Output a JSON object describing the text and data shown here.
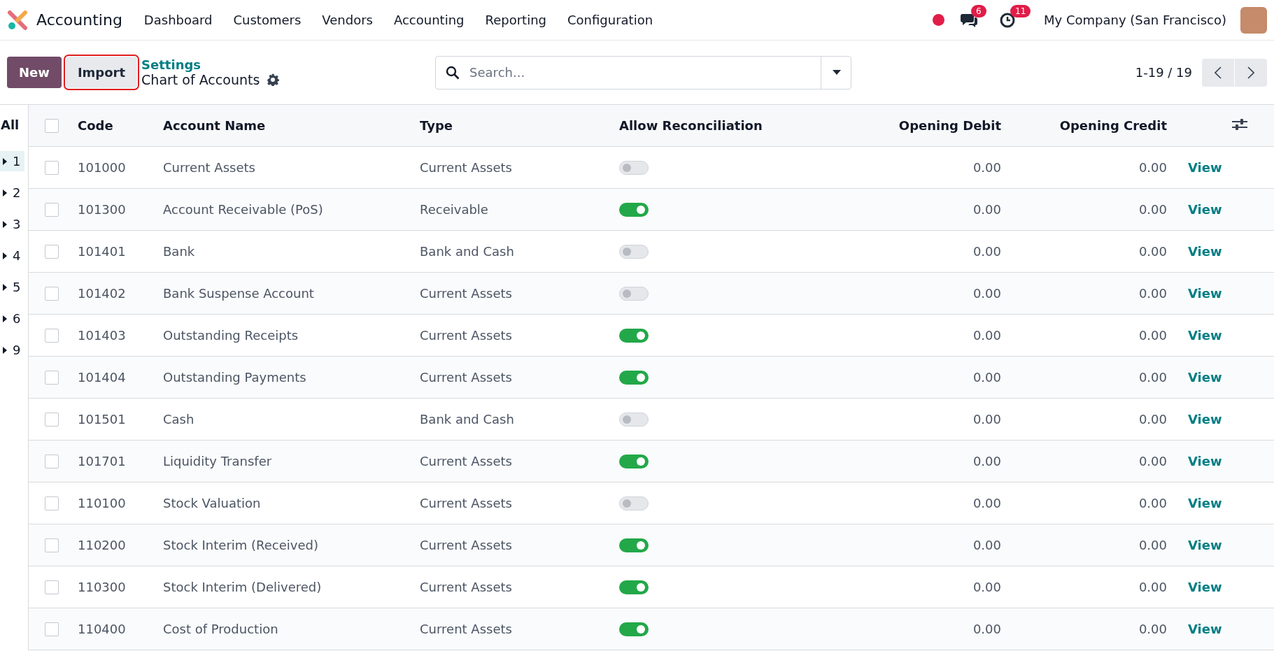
{
  "navbar": {
    "app_name": "Accounting",
    "menu": [
      "Dashboard",
      "Customers",
      "Vendors",
      "Accounting",
      "Reporting",
      "Configuration"
    ],
    "messages_count": "6",
    "activities_count": "11",
    "company": "My Company (San Francisco)"
  },
  "control_panel": {
    "buttons": [
      {
        "label": "New",
        "kind": "primary",
        "highlighted": false
      },
      {
        "label": "Import",
        "kind": "secondary",
        "highlighted": true
      }
    ],
    "breadcrumb": "Settings",
    "title": "Chart of Accounts",
    "search": {
      "placeholder": "Search..."
    },
    "pager": "1-19 / 19"
  },
  "side_panel": {
    "heading": "All",
    "groups": [
      {
        "label": "1",
        "selected": true
      },
      {
        "label": "2",
        "selected": false
      },
      {
        "label": "3",
        "selected": false
      },
      {
        "label": "4",
        "selected": false
      },
      {
        "label": "5",
        "selected": false
      },
      {
        "label": "6",
        "selected": false
      },
      {
        "label": "9",
        "selected": false
      }
    ]
  },
  "table": {
    "all_checked": false,
    "columns": [
      "Code",
      "Account Name",
      "Type",
      "Allow Reconciliation",
      "Opening Debit",
      "Opening Credit"
    ],
    "rows": [
      {
        "checked": false,
        "code": "101000",
        "name": "Current Assets",
        "type": "Current Assets",
        "reconcile": false,
        "debit": "0.00",
        "credit": "0.00",
        "action": "View"
      },
      {
        "checked": false,
        "code": "101300",
        "name": "Account Receivable (PoS)",
        "type": "Receivable",
        "reconcile": true,
        "debit": "0.00",
        "credit": "0.00",
        "action": "View"
      },
      {
        "checked": false,
        "code": "101401",
        "name": "Bank",
        "type": "Bank and Cash",
        "reconcile": false,
        "debit": "0.00",
        "credit": "0.00",
        "action": "View"
      },
      {
        "checked": false,
        "code": "101402",
        "name": "Bank Suspense Account",
        "type": "Current Assets",
        "reconcile": false,
        "debit": "0.00",
        "credit": "0.00",
        "action": "View"
      },
      {
        "checked": false,
        "code": "101403",
        "name": "Outstanding Receipts",
        "type": "Current Assets",
        "reconcile": true,
        "debit": "0.00",
        "credit": "0.00",
        "action": "View"
      },
      {
        "checked": false,
        "code": "101404",
        "name": "Outstanding Payments",
        "type": "Current Assets",
        "reconcile": true,
        "debit": "0.00",
        "credit": "0.00",
        "action": "View"
      },
      {
        "checked": false,
        "code": "101501",
        "name": "Cash",
        "type": "Bank and Cash",
        "reconcile": false,
        "debit": "0.00",
        "credit": "0.00",
        "action": "View"
      },
      {
        "checked": false,
        "code": "101701",
        "name": "Liquidity Transfer",
        "type": "Current Assets",
        "reconcile": true,
        "debit": "0.00",
        "credit": "0.00",
        "action": "View"
      },
      {
        "checked": false,
        "code": "110100",
        "name": "Stock Valuation",
        "type": "Current Assets",
        "reconcile": false,
        "debit": "0.00",
        "credit": "0.00",
        "action": "View"
      },
      {
        "checked": false,
        "code": "110200",
        "name": "Stock Interim (Received)",
        "type": "Current Assets",
        "reconcile": true,
        "debit": "0.00",
        "credit": "0.00",
        "action": "View"
      },
      {
        "checked": false,
        "code": "110300",
        "name": "Stock Interim (Delivered)",
        "type": "Current Assets",
        "reconcile": true,
        "debit": "0.00",
        "credit": "0.00",
        "action": "View"
      },
      {
        "checked": false,
        "code": "110400",
        "name": "Cost of Production",
        "type": "Current Assets",
        "reconcile": true,
        "debit": "0.00",
        "credit": "0.00",
        "action": "View"
      }
    ]
  }
}
